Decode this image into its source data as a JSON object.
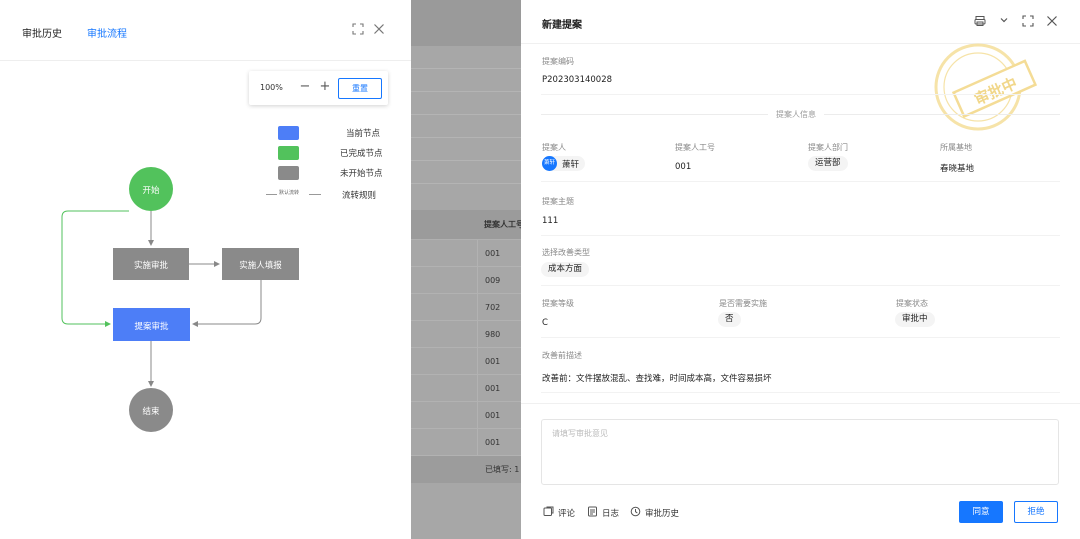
{
  "left_panel": {
    "tabs": [
      "审批历史",
      "审批流程"
    ],
    "zoom": {
      "percent": "100%",
      "minus": "−",
      "plus": "+",
      "reset": "重置"
    },
    "legend": [
      {
        "label": "当前节点",
        "color": "#4d7ef7"
      },
      {
        "label": "已完成节点",
        "color": "#52c25c"
      },
      {
        "label": "未开始节点",
        "color": "#8a8a8a"
      }
    ],
    "rule_line_text": "默认流转",
    "rule_label": "流转规则",
    "nodes": {
      "start": "开始",
      "approve": "实施审批",
      "report": "实施人填报",
      "proposal_approve": "提案审批",
      "end": "结束"
    }
  },
  "background_table": {
    "header": "提案人工号",
    "rows": [
      "001",
      "009",
      "702",
      "980",
      "001",
      "001",
      "001",
      "001"
    ],
    "footer": "已填写: 1"
  },
  "right_panel": {
    "title": "新建提案",
    "proposal_code_label": "提案编码",
    "proposal_code": "P202303140028",
    "section_title": "提案人信息",
    "proposer_label": "提案人",
    "proposer_avatar": "萧轩",
    "proposer_name": "萧轩",
    "employee_id_label": "提案人工号",
    "employee_id": "001",
    "department_label": "提案人部门",
    "department": "运营部",
    "base_label": "所属基地",
    "base": "春晓基地",
    "subject_label": "提案主题",
    "subject": "111",
    "improve_type_label": "选择改善类型",
    "improve_type": "成本方面",
    "level_label": "提案等级",
    "level": "C",
    "need_implement_label": "是否需要实施",
    "need_implement": "否",
    "status_label": "提案状态",
    "status": "审批中",
    "before_desc_label": "改善前描述",
    "before_desc": "改善前：文件摆放混乱、查找难，时间成本高，文件容易损坏",
    "stamp_text": "审批中",
    "comment_placeholder": "请填写审批意见",
    "actions": {
      "comment": "评论",
      "log": "日志",
      "history": "审批历史"
    },
    "agree": "同意",
    "reject": "拒绝"
  }
}
